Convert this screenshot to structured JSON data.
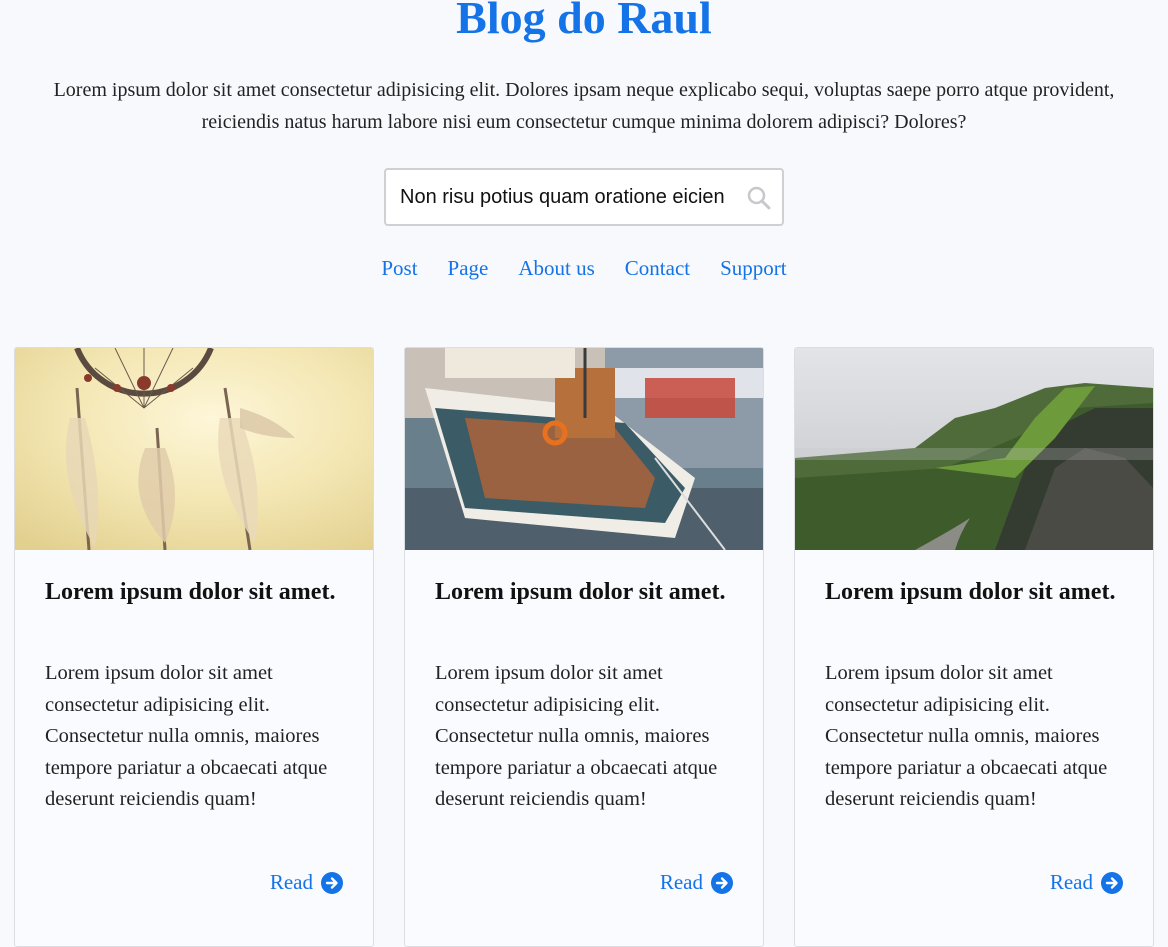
{
  "header": {
    "title": "Blog do Raul",
    "intro": "Lorem ipsum dolor sit amet consectetur adipisicing elit. Dolores ipsam neque explicabo sequi, voluptas saepe porro atque provident, reiciendis natus harum labore nisi eum consectetur cumque minima dolorem adipisci? Dolores?"
  },
  "search": {
    "value": "Non risu potius quam oratione eicien",
    "icon": "search-icon"
  },
  "nav": {
    "items": [
      {
        "label": "Post"
      },
      {
        "label": "Page"
      },
      {
        "label": "About us"
      },
      {
        "label": "Contact"
      },
      {
        "label": "Support"
      }
    ]
  },
  "cards": [
    {
      "image": "dreamcatcher",
      "title": "Lorem ipsum dolor sit amet.",
      "text": "Lorem ipsum dolor sit amet consectetur adipisicing elit. Consectetur nulla omnis, maiores tempore pariatur a obcaecati atque deserunt reiciendis quam!",
      "read_label": "Read",
      "icon": "arrow-right-circle-icon"
    },
    {
      "image": "sailing-boat",
      "title": "Lorem ipsum dolor sit amet.",
      "text": "Lorem ipsum dolor sit amet consectetur adipisicing elit. Consectetur nulla omnis, maiores tempore pariatur a obcaecati atque deserunt reiciendis quam!",
      "read_label": "Read",
      "icon": "arrow-right-circle-icon"
    },
    {
      "image": "green-cliffs",
      "title": "Lorem ipsum dolor sit amet.",
      "text": "Lorem ipsum dolor sit amet consectetur adipisicing elit. Consectetur nulla omnis, maiores tempore pariatur a obcaecati atque deserunt reiciendis quam!",
      "read_label": "Read",
      "icon": "arrow-right-circle-icon"
    }
  ],
  "colors": {
    "accent": "#1473e6",
    "background": "#f8f9fd",
    "card_border": "#dcdde3"
  }
}
